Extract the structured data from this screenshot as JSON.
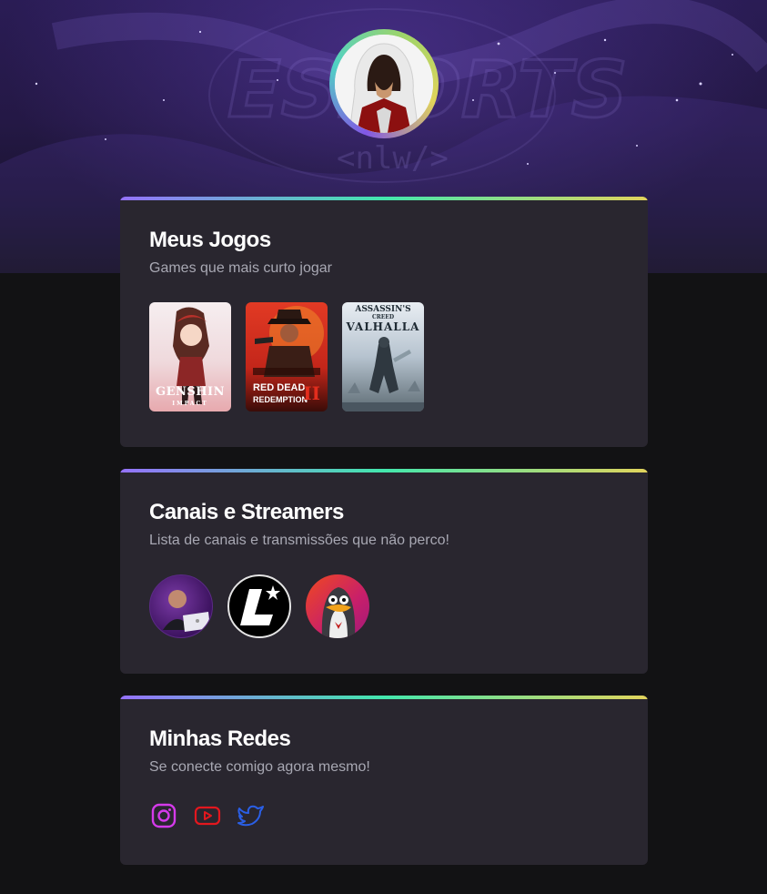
{
  "profile": {
    "avatar_alt": "Ezio Auditore avatar"
  },
  "hero": {
    "logo_text": "ESPORTS",
    "logo_sub": "<nlw/>"
  },
  "sections": {
    "games": {
      "title": "Meus Jogos",
      "subtitle": "Games que mais curto jogar",
      "items": [
        {
          "name": "Genshin Impact",
          "caption_line1": "GENSHIN",
          "caption_line2": "IMPACT"
        },
        {
          "name": "Red Dead Redemption II",
          "caption_line1": "RED DEAD",
          "caption_line2": "REDEMPTION",
          "caption_numeral": "II"
        },
        {
          "name": "Assassin's Creed Valhalla",
          "caption_line1": "ASSASSIN'S",
          "caption_line2": "CREED",
          "caption_line3": "VALHALLA"
        }
      ]
    },
    "streamers": {
      "title": "Canais e Streamers",
      "subtitle": "Lista de canais e transmissões que não perco!"
    },
    "socials": {
      "title": "Minhas Redes",
      "subtitle": "Se conecte comigo agora mesmo!",
      "items": [
        {
          "icon": "instagram-icon",
          "color": "#d43aea"
        },
        {
          "icon": "youtube-icon",
          "color": "#e3171e"
        },
        {
          "icon": "twitter-icon",
          "color": "#2a5fe6"
        }
      ]
    }
  },
  "theme": {
    "background": "#121214",
    "card": "#29262f",
    "gradient": [
      "#9572fc",
      "#43e7ad",
      "#e2d45c"
    ],
    "text_primary": "#ffffff",
    "text_secondary": "#a8a8b3"
  }
}
